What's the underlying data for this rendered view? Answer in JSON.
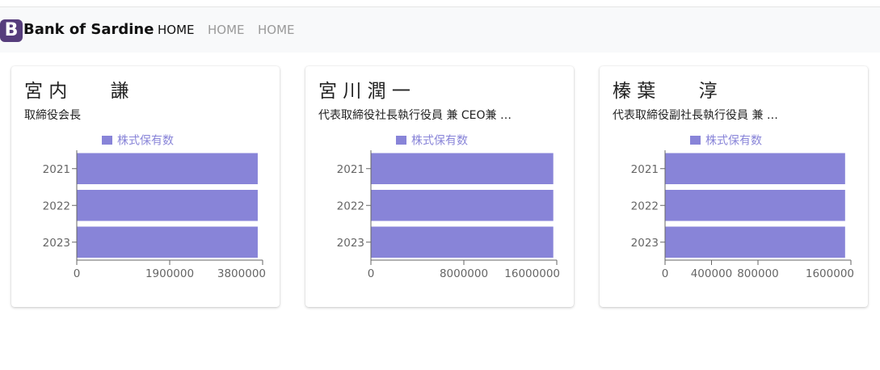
{
  "navbar": {
    "brand_letter": "B",
    "brand_name": "Bank of Sardine",
    "links": [
      "HOME",
      "HOME",
      "HOME"
    ]
  },
  "colors": {
    "bar": "#8884d8",
    "axis": "#666666"
  },
  "cards": [
    {
      "name": "宮 内　　 謙",
      "title": "取締役会長"
    },
    {
      "name": "宮 川 潤 一",
      "title": "代表取締役社長執行役員 兼 CEO兼 …"
    },
    {
      "name": "榛 葉　　 淳",
      "title": "代表取締役副社長執行役員 兼 …"
    }
  ],
  "chart_data": [
    {
      "type": "bar",
      "orientation": "horizontal",
      "categories": [
        "2021",
        "2022",
        "2023"
      ],
      "series": [
        {
          "name": "株式保有数",
          "values": [
            3700000,
            3700000,
            3700000
          ]
        }
      ],
      "xlim": [
        0,
        3800000
      ],
      "xticks": [
        "0",
        "1900000",
        "3800000"
      ],
      "legend": "top"
    },
    {
      "type": "bar",
      "orientation": "horizontal",
      "categories": [
        "2021",
        "2022",
        "2023"
      ],
      "series": [
        {
          "name": "株式保有数",
          "values": [
            15700000,
            15700000,
            15700000
          ]
        }
      ],
      "xlim": [
        0,
        16000000
      ],
      "xticks": [
        "0",
        "8000000",
        "16000000"
      ],
      "legend": "top"
    },
    {
      "type": "bar",
      "orientation": "horizontal",
      "categories": [
        "2021",
        "2022",
        "2023"
      ],
      "series": [
        {
          "name": "株式保有数",
          "values": [
            1550000,
            1550000,
            1550000
          ]
        }
      ],
      "xlim": [
        0,
        1600000
      ],
      "xticks": [
        "0",
        "400000",
        "800000",
        "1600000"
      ],
      "legend": "top"
    }
  ]
}
